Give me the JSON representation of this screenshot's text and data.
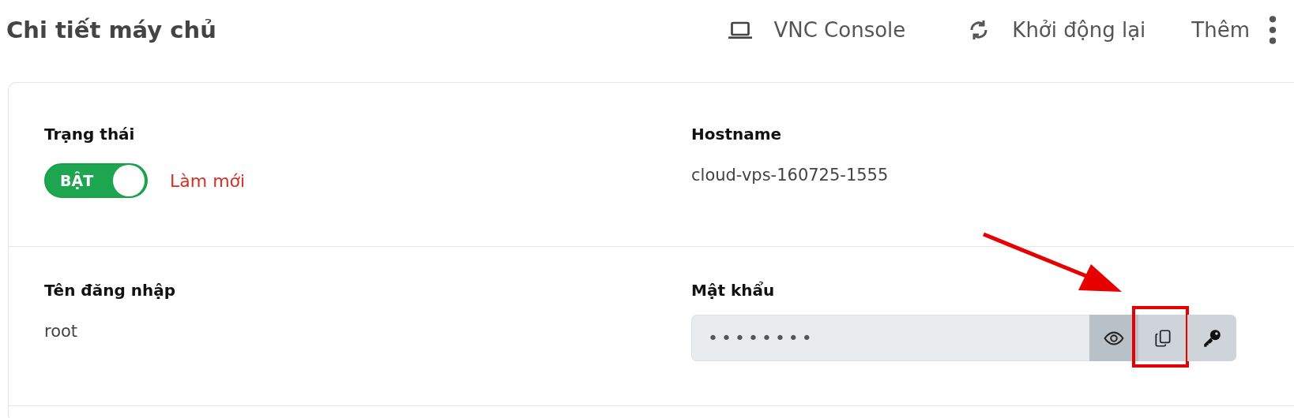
{
  "page": {
    "title": "Chi tiết máy chủ"
  },
  "actions": [
    {
      "kind": "vnc",
      "label": "VNC Console"
    },
    {
      "kind": "restart",
      "label": "Khởi động lại"
    },
    {
      "kind": "more",
      "label": "Thêm"
    }
  ],
  "status": {
    "label": "Trạng thái",
    "toggle": {
      "on": true,
      "label": "BẬT"
    },
    "refresh_link": "Làm mới"
  },
  "hostname": {
    "label": "Hostname",
    "value": "cloud-vps-160725-1555"
  },
  "username": {
    "label": "Tên đăng nhập",
    "value": "root"
  },
  "password": {
    "label": "Mật khẩu",
    "value": "••••••••",
    "buttons": [
      {
        "kind": "show",
        "pressed": true,
        "highlighted": false
      },
      {
        "kind": "copy",
        "pressed": false,
        "highlighted": true
      },
      {
        "kind": "reset",
        "pressed": false,
        "highlighted": false
      }
    ]
  }
}
